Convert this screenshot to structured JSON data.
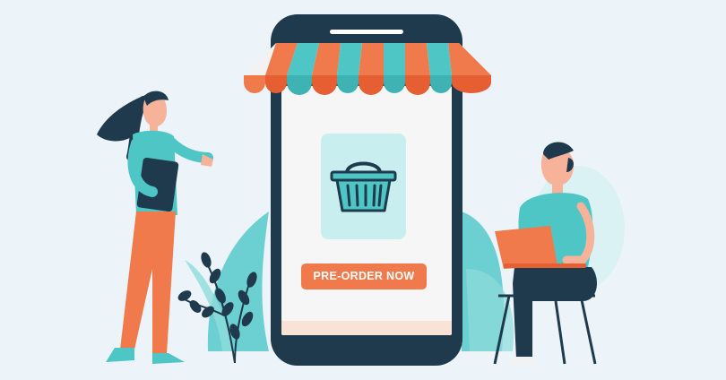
{
  "cta": {
    "label": "PRE-ORDER NOW"
  },
  "icons": {
    "basket": "shopping-basket-icon",
    "awning": "shop-awning"
  },
  "colors": {
    "background": "#ecf4fa",
    "phone": "#1f3a4c",
    "screen": "#f6f6f6",
    "accent_orange": "#f07a4b",
    "accent_teal": "#4fc6c6",
    "basket_card": "#c8eef0"
  }
}
